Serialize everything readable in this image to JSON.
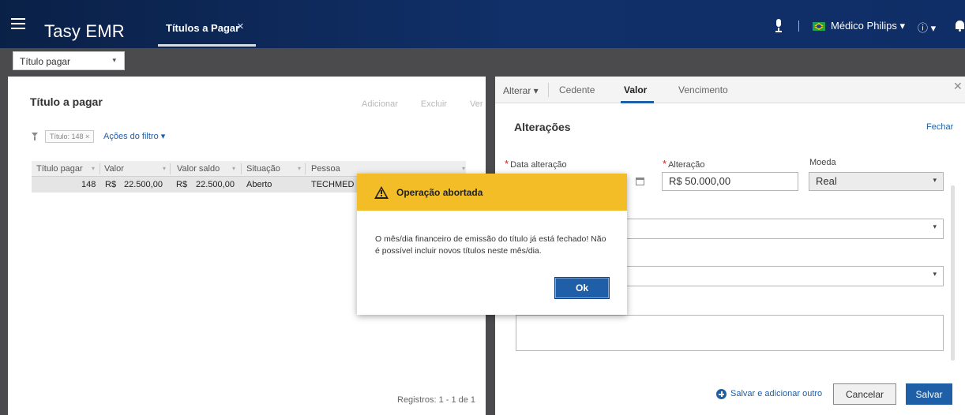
{
  "app": {
    "title": "Tasy EMR",
    "tab_label": "Títulos a Pagar",
    "tab_close": "×",
    "user": "Médico Philips",
    "user_caret": "▾",
    "info_icon": "ⓘ",
    "info_caret": "▾"
  },
  "toolbar": {
    "context_select": "Título pagar",
    "caret": "▾"
  },
  "left_panel": {
    "title": "Título a pagar",
    "actions": [
      "Adicionar",
      "Excluir",
      "Ver"
    ],
    "filter_chip": "Título: 148 ×",
    "filter_actions": "Ações do filtro ▾",
    "columns": [
      "Título pagar",
      "Valor",
      "Valor saldo",
      "Situação",
      "Pessoa"
    ],
    "rows": [
      [
        "148",
        "R$",
        "22.500,00",
        "R$",
        "22.500,00",
        "Aberto",
        "TECHMED MA"
      ]
    ],
    "registros": "Registros: 1 - 1 de 1"
  },
  "right_panel": {
    "alterar": "Alterar ▾",
    "tabs": [
      "Cedente",
      "Valor",
      "Vencimento"
    ],
    "active_tab": "Valor",
    "close": "✕",
    "title": "Alterações",
    "fechar": "Fechar",
    "fields": {
      "data_alteracao_label": "Data alteração",
      "alteracao_label": "Alteração",
      "alteracao_value": "R$ 50.000,00",
      "moeda_label": "Moeda",
      "moeda_value": "Real",
      "required_mark": "*"
    },
    "save_add_label": "Salvar e adicionar outro",
    "cancel_label": "Cancelar",
    "save_label": "Salvar"
  },
  "modal": {
    "title": "Operação abortada",
    "message": "O mês/dia financeiro de emissão do título já está fechado! Não é possível incluir novos títulos neste mês/dia.",
    "ok_label": "Ok"
  },
  "colors": {
    "topbar": "#0a2147",
    "accent": "#1f5fa8",
    "warning": "#f2bd27",
    "backdrop": "#4b4b4e"
  }
}
